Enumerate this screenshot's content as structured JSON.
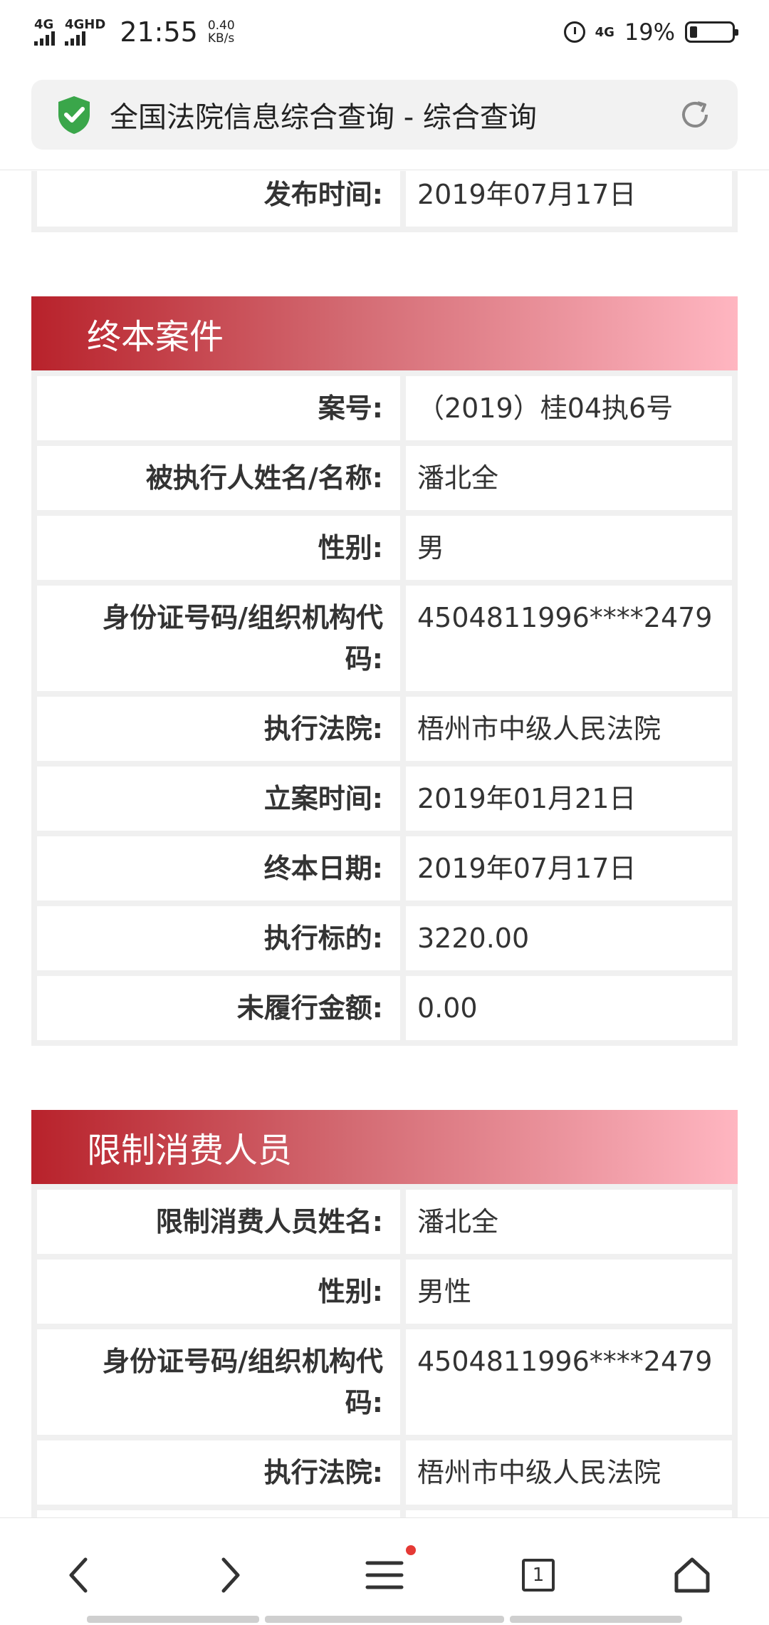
{
  "status_bar": {
    "signal1": "4G",
    "signal2": "4GHD",
    "time": "21:55",
    "speed_value": "0.40",
    "speed_unit": "KB/s",
    "network_right": "4G",
    "battery_percent": "19%",
    "battery_level": 0.19
  },
  "address_bar": {
    "title": "全国法院信息综合查询 - 综合查询"
  },
  "top_table": {
    "rows": [
      {
        "label": "发布时间:",
        "value": "2019年07月17日"
      }
    ]
  },
  "section1": {
    "title": "终本案件",
    "rows": [
      {
        "label": "案号:",
        "value": "（2019）桂04执6号"
      },
      {
        "label": "被执行人姓名/名称:",
        "value": "潘北全"
      },
      {
        "label": "性别:",
        "value": "男"
      },
      {
        "label": "身份证号码/组织机构代码:",
        "value": "4504811996****2479"
      },
      {
        "label": "执行法院:",
        "value": "梧州市中级人民法院"
      },
      {
        "label": "立案时间:",
        "value": "2019年01月21日"
      },
      {
        "label": "终本日期:",
        "value": "2019年07月17日"
      },
      {
        "label": "执行标的:",
        "value": "3220.00"
      },
      {
        "label": "未履行金额:",
        "value": "0.00"
      }
    ]
  },
  "section2": {
    "title": "限制消费人员",
    "rows": [
      {
        "label": "限制消费人员姓名:",
        "value": "潘北全"
      },
      {
        "label": "性别:",
        "value": "男性"
      },
      {
        "label": "身份证号码/组织机构代码:",
        "value": "4504811996****2479"
      },
      {
        "label": "执行法院:",
        "value": "梧州市中级人民法院"
      }
    ]
  },
  "bottom_nav": {
    "tabs_count": "1",
    "items": [
      "back-icon",
      "forward-icon",
      "menu-icon",
      "tabs-icon",
      "home-icon"
    ]
  },
  "colors": {
    "header_start": "#b8222b",
    "header_end": "#ffb6c1",
    "shield_green": "#3aa64a",
    "badge_red": "#e53935"
  }
}
